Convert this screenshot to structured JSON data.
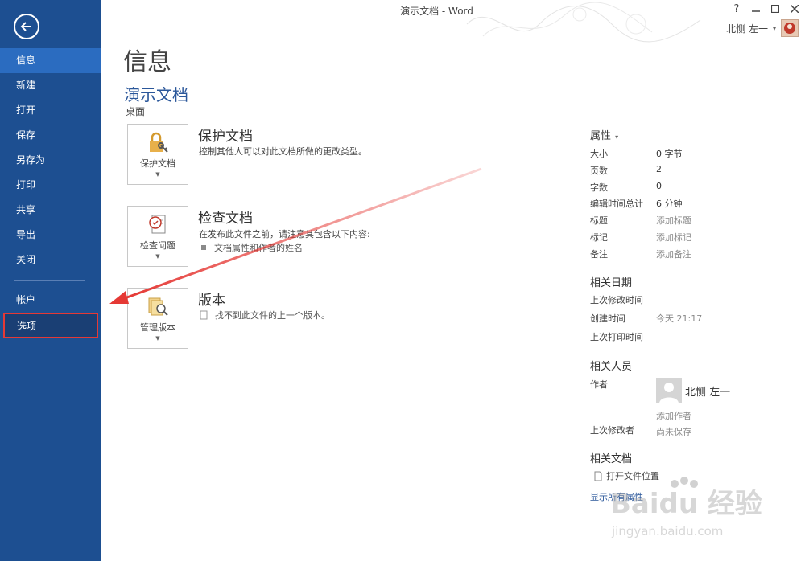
{
  "window": {
    "title": "演示文档 - Word",
    "help": "?",
    "user_name": "北恻 左一"
  },
  "sidebar": {
    "items": [
      {
        "label": "信息"
      },
      {
        "label": "新建"
      },
      {
        "label": "打开"
      },
      {
        "label": "保存"
      },
      {
        "label": "另存为"
      },
      {
        "label": "打印"
      },
      {
        "label": "共享"
      },
      {
        "label": "导出"
      },
      {
        "label": "关闭"
      }
    ],
    "account": "帐户",
    "options": "选项"
  },
  "main": {
    "title": "信息",
    "doc_name": "演示文档",
    "doc_location": "桌面",
    "protect": {
      "button": "保护文档",
      "heading": "保护文档",
      "desc": "控制其他人可以对此文档所做的更改类型。"
    },
    "inspect": {
      "button": "检查问题",
      "heading": "检查文档",
      "desc": "在发布此文件之前，请注意其包含以下内容:",
      "bullet": "文档属性和作者的姓名"
    },
    "versions": {
      "button": "管理版本",
      "heading": "版本",
      "desc": "找不到此文件的上一个版本。"
    }
  },
  "properties": {
    "heading": "属性",
    "rows": [
      {
        "key": "大小",
        "value": "0 字节"
      },
      {
        "key": "页数",
        "value": "2"
      },
      {
        "key": "字数",
        "value": "0"
      },
      {
        "key": "编辑时间总计",
        "value": "6 分钟"
      },
      {
        "key": "标题",
        "value": "添加标题"
      },
      {
        "key": "标记",
        "value": "添加标记"
      },
      {
        "key": "备注",
        "value": "添加备注"
      }
    ],
    "dates_heading": "相关日期",
    "dates": [
      {
        "key": "上次修改时间",
        "value": ""
      },
      {
        "key": "创建时间",
        "value": "今天 21:17"
      },
      {
        "key": "上次打印时间",
        "value": ""
      }
    ],
    "people_heading": "相关人员",
    "author_label": "作者",
    "author_name": "北恻 左一",
    "add_author": "添加作者",
    "last_modified_by_label": "上次修改者",
    "last_modified_by_value": "尚未保存",
    "docs_heading": "相关文档",
    "open_location": "打开文件位置",
    "show_all": "显示所有属性"
  },
  "watermark": {
    "line1": "Baidu 经验",
    "line2": "jingyan.baidu.com"
  },
  "colors": {
    "sidebar": "#1d4f91",
    "sidebar_active": "#2b6cc0",
    "accent_blue": "#2b579a",
    "highlight_red": "#e53935"
  }
}
